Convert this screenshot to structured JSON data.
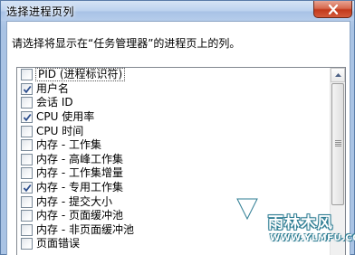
{
  "window": {
    "title": "选择进程页列"
  },
  "instruction": "请选择将显示在“任务管理器”的进程页上的列。",
  "columns": [
    {
      "label": "PID (进程标识符)",
      "checked": false
    },
    {
      "label": "用户名",
      "checked": true
    },
    {
      "label": "会话 ID",
      "checked": false
    },
    {
      "label": "CPU 使用率",
      "checked": true
    },
    {
      "label": "CPU 时间",
      "checked": false
    },
    {
      "label": "内存 - 工作集",
      "checked": false
    },
    {
      "label": "内存 - 高峰工作集",
      "checked": false
    },
    {
      "label": "内存 - 工作集增量",
      "checked": false
    },
    {
      "label": "内存 - 专用工作集",
      "checked": true
    },
    {
      "label": "内存 - 提交大小",
      "checked": false
    },
    {
      "label": "内存 - 页面缓冲池",
      "checked": false
    },
    {
      "label": "内存 - 非页面缓冲池",
      "checked": false
    },
    {
      "label": "页面错误",
      "checked": false
    }
  ],
  "watermark": {
    "name": "雨林木风",
    "url": "WWW.YLMFU.COM"
  },
  "colors": {
    "close_button": "#c2391c",
    "title_bar": "#b6cdeb",
    "checkmark": "#2d4f8e"
  }
}
